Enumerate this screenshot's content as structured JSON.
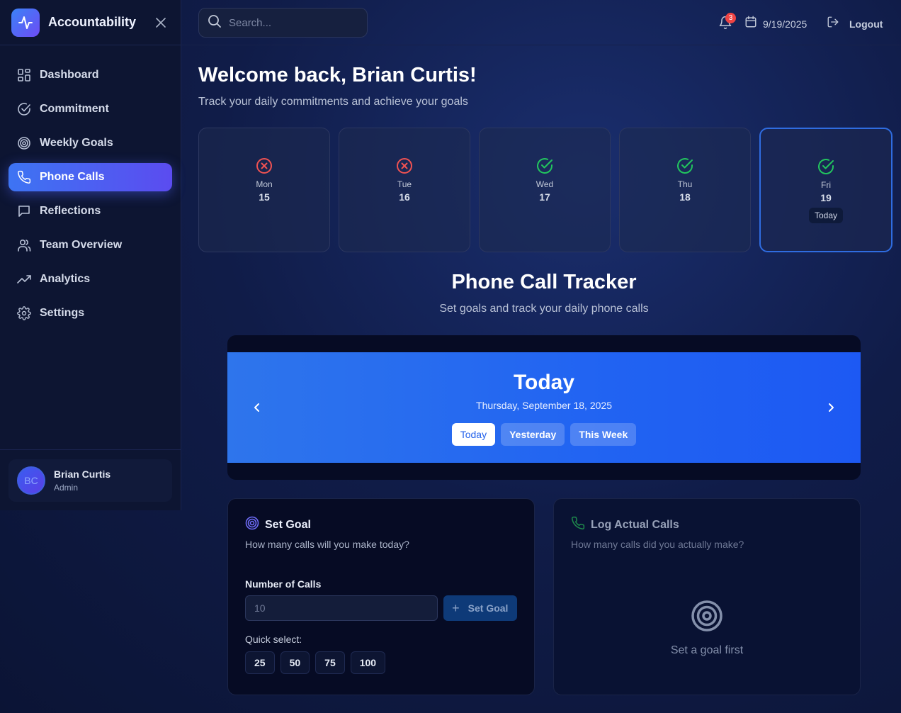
{
  "sidebar": {
    "app_title": "Accountability",
    "items": [
      {
        "label": "Dashboard",
        "icon": "grid-icon"
      },
      {
        "label": "Commitment",
        "icon": "check-circle-icon"
      },
      {
        "label": "Weekly Goals",
        "icon": "target-icon"
      },
      {
        "label": "Phone Calls",
        "icon": "phone-icon",
        "active": true
      },
      {
        "label": "Reflections",
        "icon": "message-icon"
      },
      {
        "label": "Team Overview",
        "icon": "users-icon"
      },
      {
        "label": "Analytics",
        "icon": "trend-icon"
      },
      {
        "label": "Settings",
        "icon": "gear-icon"
      }
    ],
    "user": {
      "initials": "BC",
      "name": "Brian Curtis",
      "role": "Admin"
    }
  },
  "topbar": {
    "search_placeholder": "Search...",
    "notification_count": "3",
    "date": "9/19/2025",
    "logout_label": "Logout"
  },
  "welcome": {
    "title": "Welcome back, Brian Curtis!",
    "subtitle": "Track your daily commitments and achieve your goals"
  },
  "week": [
    {
      "day": "Mon",
      "date": "15",
      "status": "missed"
    },
    {
      "day": "Tue",
      "date": "16",
      "status": "missed"
    },
    {
      "day": "Wed",
      "date": "17",
      "status": "done"
    },
    {
      "day": "Thu",
      "date": "18",
      "status": "done"
    },
    {
      "day": "Fri",
      "date": "19",
      "status": "done",
      "today_label": "Today"
    }
  ],
  "tracker": {
    "title": "Phone Call Tracker",
    "subtitle": "Set goals and track your daily phone calls",
    "banner_title": "Today",
    "banner_date": "Thursday, September 18, 2025",
    "ranges": [
      "Today",
      "Yesterday",
      "This Week"
    ]
  },
  "set_goal": {
    "title": "Set Goal",
    "subtitle": "How many calls will you make today?",
    "field_label": "Number of Calls",
    "placeholder": "10",
    "button_label": "Set Goal",
    "quick_label": "Quick select:",
    "quick_options": [
      "25",
      "50",
      "75",
      "100"
    ]
  },
  "log_calls": {
    "title": "Log Actual Calls",
    "subtitle": "How many calls did you actually make?",
    "empty_text": "Set a goal first"
  },
  "colors": {
    "accent": "#3d74f3",
    "success": "#22c55e",
    "danger": "#f05252",
    "banner": "#2563eb"
  }
}
